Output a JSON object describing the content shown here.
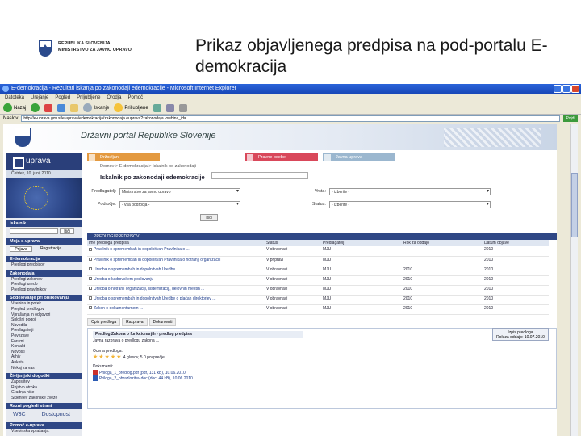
{
  "slide": {
    "ministry_line1": "REPUBLIKA SLOVENIJA",
    "ministry_line2": "MINISTRSTVO ZA JAVNO UPRAVO",
    "title": "Prikaz objavljenega predpisa na pod-portalu E-demokracija"
  },
  "browser": {
    "window_title": "E-demokracija - Rezultati iskanja po zakonodaji edemokracije - Microsoft Internet Explorer",
    "menu": [
      "Datoteka",
      "Urejanje",
      "Pogled",
      "Priljubljene",
      "Orodja",
      "Pomoč"
    ],
    "toolbar": {
      "back": "Nazaj",
      "search": "Iskanje",
      "favorites": "Priljubljene"
    },
    "address_label": "Naslov",
    "address_value": "http://e-uprava.gov.si/e-uprava/edemokracija/zakonodaja.euprava?zakonodaja.vsebina_id=...",
    "go_label": "Pojdi"
  },
  "portal": {
    "name": "Državni portal Republike Slovenije",
    "logo": "uprava",
    "date": "Četrtek, 10. junij 2010",
    "tabs": [
      "Državljani",
      "Pravne osebe",
      "Javna uprava"
    ],
    "breadcrumb": "Domov > E-demokracija > Iskalnik po zakonodaji",
    "search_title": "Iskalnik po zakonodaji edemokracije",
    "form": {
      "row1_label": "Predlagatelj:",
      "row1_value": "Ministrstvo za javno upravo",
      "row1b_label": "Vrsta:",
      "row1b_value": "- izberite -",
      "row2_label": "Področje:",
      "row2_value": "- vsa področja -",
      "row2b_label": "Status:",
      "row2b_value": "- izberite -",
      "go": "Išči"
    }
  },
  "sidebar": {
    "search_head": "Iskalnik",
    "search_btn": "Išči",
    "my_head": "Moja e-uprava",
    "login": "Prijava",
    "register": "Registracija",
    "edem_head": "E-demokracija",
    "edem_items": [
      "Predlogi predpisov"
    ],
    "law_head": "Zakonodaja",
    "law_items": [
      "Predlogi zakonov",
      "Predlogi uredb",
      "Predlogi pravilnikov"
    ],
    "coop_head": "Sodelovanje pri oblikovanju",
    "coop_items": [
      "Vsebina in potek",
      "Pregled predlogov",
      "Vprašanja in odgovori",
      "Splošni pogoji",
      "Navodila",
      "Predlagatelji",
      "Povezave",
      "Forumi",
      "Kontakt",
      "Novosti",
      "Arhiv",
      "Anketa",
      "Nekaj za vas"
    ],
    "life_head": "Življenjski dogodki",
    "life_items": [
      "Zaposlitev",
      "Rojstvo otroka",
      "Gradnja hiše",
      "Sklenitev zakonske zveze"
    ],
    "access_head": "Razni pogledi strani",
    "access_items": [
      "W3C",
      "Dostopnost"
    ],
    "help_head": "Pomoč e-uprava",
    "help_item": "Vsebinska vprašanja:"
  },
  "results": {
    "header": "PREDLOGI PREDPISOV",
    "columns": [
      "Ime predloga predpisa",
      "Status",
      "Predlagatelj",
      "Rok za oddajo",
      "Datum objave"
    ],
    "rows": [
      {
        "title": "Pravilnik o spremembah in dopolnitvah Pravilnika o ...",
        "status": "V obravnavi",
        "org": "MJU",
        "deadline": "",
        "date": "2010"
      },
      {
        "title": "Pravilnik o spremembah in dopolnitvah Pravilnika o notranji organizaciji",
        "status": "V pripravi",
        "org": "MJU",
        "deadline": "",
        "date": "2010"
      },
      {
        "title": "Uredba o spremembah in dopolnitvah Uredbe ...",
        "status": "V obravnavi",
        "org": "MJU",
        "deadline": "2010",
        "date": "2010"
      },
      {
        "title": "Uredba o kadrovskem poslovanju",
        "status": "V obravnavi",
        "org": "MJU",
        "deadline": "2010",
        "date": "2010"
      },
      {
        "title": "Uredba o notranji organizaciji, sistemizaciji, delovnih mestih ...",
        "status": "V obravnavi",
        "org": "MJU",
        "deadline": "2010",
        "date": "2010"
      },
      {
        "title": "Uredba o spremembah in dopolnitvah Uredbe o plačah direktorjev ...",
        "status": "V obravnavi",
        "org": "MJU",
        "deadline": "2010",
        "date": "2010"
      },
      {
        "title": "Zakon o dokumentarnem ...",
        "status": "V obravnavi",
        "org": "MJU",
        "deadline": "2010",
        "date": "2010"
      }
    ]
  },
  "detail": {
    "tabs": [
      "Opis predloga",
      "Razprava",
      "Dokumenti"
    ],
    "title": "Predlog Zakona o funkcionarjih - predlog predpisa",
    "text": "Javna razprava o predlogu zakona ...",
    "rating_label": "Ocena predloga:",
    "rating_stars": "★★★★★",
    "rating_text": "4 glasov, 5.0 povprečje",
    "attachments_label": "Dokumenti:",
    "att1": "Priloga_1_predlog.pdf (pdf, 131 kB), 10.06.2010",
    "att2": "Priloga_2_obrazlozitev.doc (doc, 44 kB), 10.06.2010",
    "print_btn": "Izpis predloga",
    "deadline_label": "Rok za oddajo: 10.07.2010"
  }
}
